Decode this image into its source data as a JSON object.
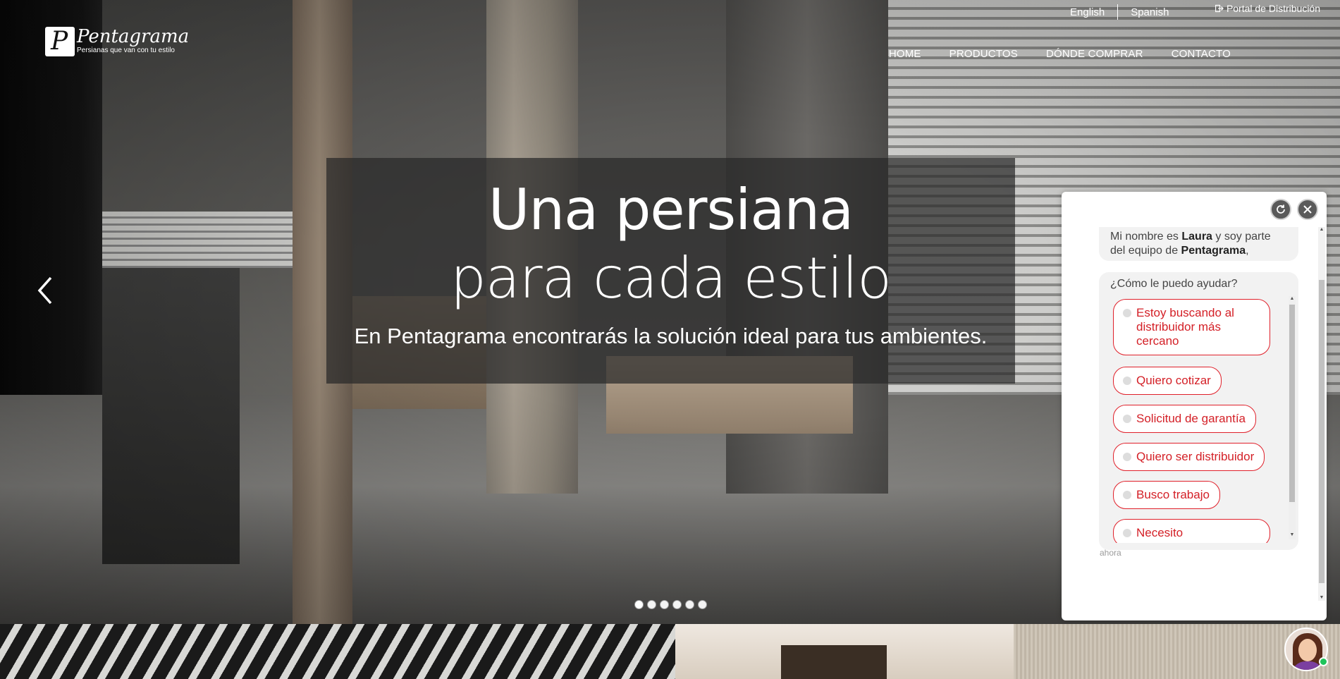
{
  "header": {
    "languages": [
      "English",
      "Spanish"
    ],
    "portal_label": "Portal de Distribución",
    "logo": {
      "name": "Pentagrama",
      "tagline": "Persianas que van con tu estilo",
      "mark": "P"
    },
    "nav": [
      "HOME",
      "PRODUCTOS",
      "DÓNDE COMPRAR",
      "CONTACTO"
    ]
  },
  "hero": {
    "title_line1": "Una persiana",
    "title_line2": "para cada estilo",
    "subtitle": "En Pentagrama encontrarás la solución ideal para tus ambientes.",
    "slide_count": 6,
    "active_slide": 1
  },
  "chat": {
    "intro_prefix": "Mi nombre es ",
    "agent_name": "Laura",
    "intro_middle": " y soy parte del equipo de ",
    "company": "Pentagrama",
    "intro_suffix": ",",
    "question": "¿Cómo le puedo ayudar?",
    "options": [
      "Estoy buscando al distribuidor más cercano",
      "Quiero cotizar",
      "Solicitud de garantía",
      "Quiero ser distribuidor",
      "Busco trabajo",
      "Necesito"
    ],
    "timestamp": "ahora"
  },
  "colors": {
    "accent": "#d42027",
    "caption_bg": "#282828",
    "chat_bubble": "#f2f2f2"
  }
}
